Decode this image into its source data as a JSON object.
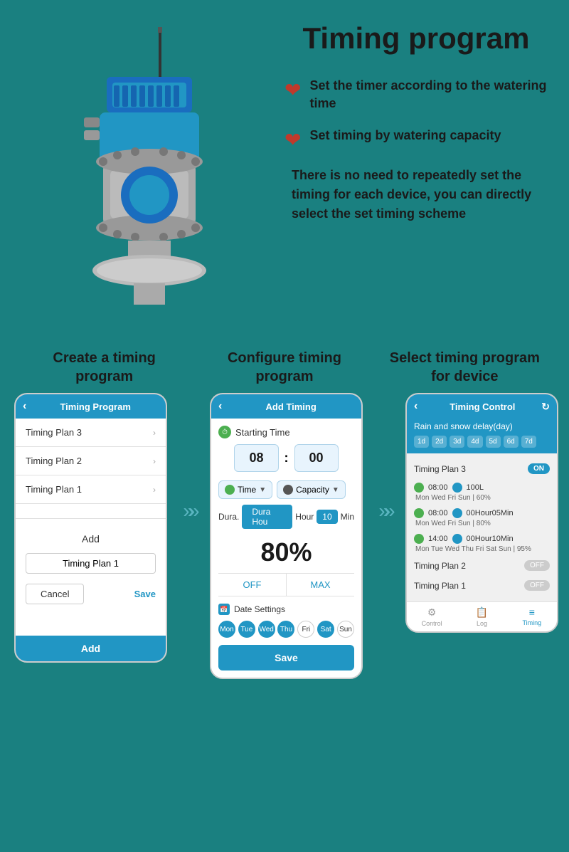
{
  "page": {
    "title": "Timing program",
    "bg_color": "#1a8080"
  },
  "features": {
    "item1": "Set the timer according to the watering time",
    "item2": "Set timing by watering capacity",
    "description": "There is no need to repeatedly set the timing for each device, you can directly select the set timing scheme"
  },
  "step1": {
    "label": "Create a timing program",
    "header_title": "Timing Program",
    "items": [
      "Timing Plan 3",
      "Timing Plan 2",
      "Timing Plan 1"
    ],
    "add_label": "Add",
    "input_placeholder": "Timing Plan 1",
    "cancel_label": "Cancel",
    "save_label": "Save",
    "footer_add": "Add"
  },
  "step2": {
    "label": "Configure timing program",
    "header_title": "Add Timing",
    "starting_time_label": "Starting Time",
    "hour": "08",
    "minute": "00",
    "time_label": "Time",
    "capacity_label": "Capacity",
    "dura_label": "Dura.",
    "hour_label": "Hour",
    "min_num": "10",
    "min_label": "Min",
    "percent": "80%",
    "off_label": "OFF",
    "max_label": "MAX",
    "date_settings": "Date Settings",
    "days": [
      "Mon",
      "Tue",
      "Wed",
      "Thu",
      "Fri",
      "Sat",
      "Sun"
    ],
    "active_days": [
      1,
      1,
      1,
      1,
      0,
      1,
      0
    ],
    "save_label": "Save"
  },
  "step3": {
    "label": "Select timing program for device",
    "header_title": "Timing Control",
    "sub_label": "Rain and snow delay(day)",
    "day_btns": [
      "1d",
      "2d",
      "3d",
      "4d",
      "5d",
      "6d",
      "7d"
    ],
    "plan3_label": "Timing Plan 3",
    "plan3_state": "ON",
    "entry1_time": "08:00",
    "entry1_capacity": "100L",
    "entry1_days": "Mon Wed Fri Sun | 60%",
    "entry2_time": "08:00",
    "entry2_duration": "00Hour05Min",
    "entry2_days": "Mon Wed Fri Sun | 80%",
    "entry3_time": "14:00",
    "entry3_duration": "00Hour10Min",
    "entry3_days": "Mon Tue Wed Thu Fri Sat Sun | 95%",
    "plan2_label": "Timing Plan 2",
    "plan2_state": "OFF",
    "plan1_label": "Timing Plan 1",
    "plan1_state": "OFF",
    "footer": {
      "control_label": "Control",
      "log_label": "Log",
      "timing_label": "Timing"
    }
  },
  "arrows": {
    "double": "»»"
  }
}
